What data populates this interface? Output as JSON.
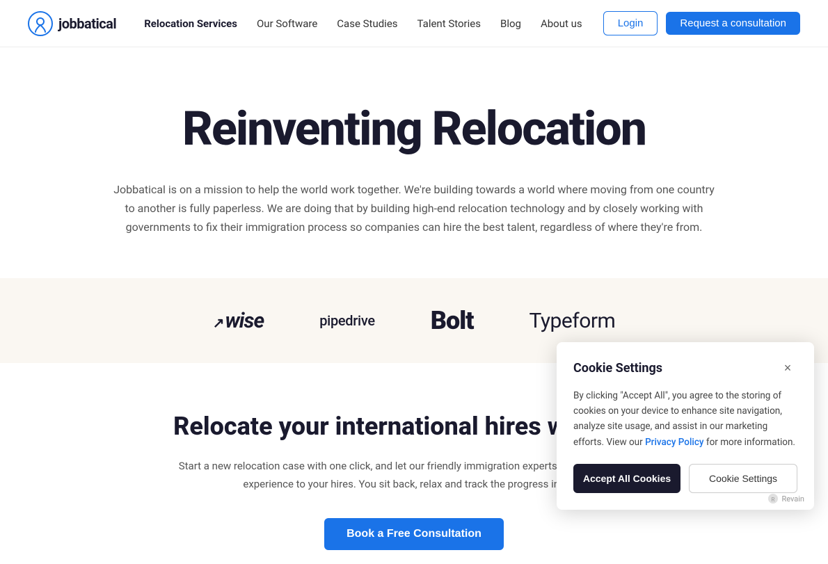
{
  "logo": {
    "text": "jobbatical",
    "icon_label": "location-pin-icon"
  },
  "nav": {
    "links": [
      {
        "label": "Relocation Services",
        "active": true,
        "name": "nav-relocation"
      },
      {
        "label": "Our Software",
        "active": false,
        "name": "nav-software"
      },
      {
        "label": "Case Studies",
        "active": false,
        "name": "nav-case-studies"
      },
      {
        "label": "Talent Stories",
        "active": false,
        "name": "nav-talent-stories"
      },
      {
        "label": "Blog",
        "active": false,
        "name": "nav-blog"
      },
      {
        "label": "About us",
        "active": false,
        "name": "nav-about"
      }
    ],
    "login_label": "Login",
    "consultation_label": "Request a consultation"
  },
  "hero": {
    "title": "Reinventing Relocation",
    "description": "Jobbatical is on a mission to help the world work together. We're building towards a world where moving from one country to another is fully paperless. We are doing that by building high-end relocation technology and by closely working with governments to fix their immigration process so companies can hire the best talent, regardless of where they're from."
  },
  "logos": [
    {
      "label": "Wise",
      "style": "wise"
    },
    {
      "label": "pipedrive",
      "style": "pipedrive"
    },
    {
      "label": "Bolt",
      "style": "bolt"
    },
    {
      "label": "Typeform",
      "style": "typeform"
    }
  ],
  "second_section": {
    "title": "Relocate your international hires with",
    "description": "Start a new relocation case with one click, and let our friendly immigration experts provide a seamless experience to your hires. You sit back, relax and track the progress in our...",
    "cta_label": "Book a Free Consultation"
  },
  "cookie_modal": {
    "title": "Cookie Settings",
    "body": "By clicking \"Accept All\", you agree to the storing of cookies on your device to enhance site navigation, analyze site usage, and assist in our marketing efforts. View our",
    "privacy_link_text": "Privacy Policy",
    "body_suffix": "for more information.",
    "accept_label": "Accept All Cookies",
    "settings_label": "Cookie Settings",
    "close_label": "×"
  }
}
